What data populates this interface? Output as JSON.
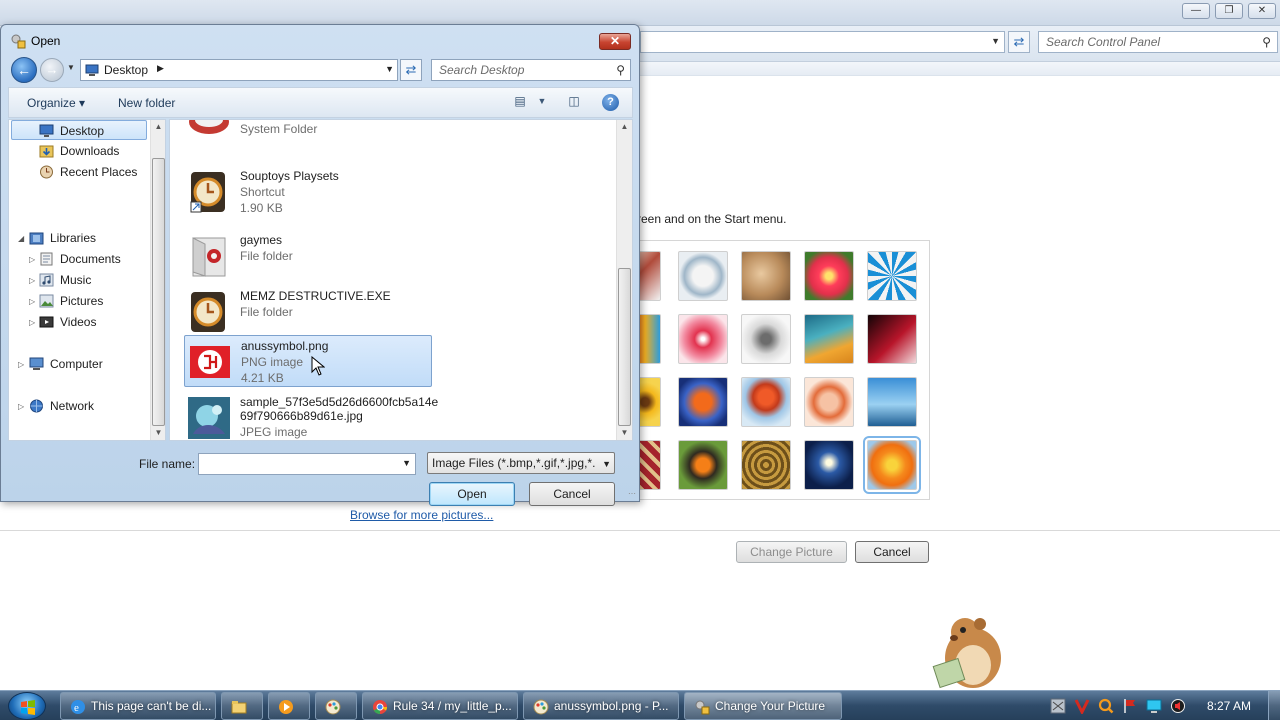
{
  "control_panel": {
    "search_placeholder": "Search Control Panel",
    "description": "reen and on the Start menu.",
    "browse_link": "Browse for more pictures...",
    "change_picture_button": "Change Picture",
    "cancel_button": "Cancel",
    "window_controls": [
      "minimize",
      "restore",
      "close"
    ]
  },
  "dialog": {
    "title": "Open",
    "location": "Desktop",
    "search_placeholder": "Search Desktop",
    "toolbar": {
      "organize": "Organize",
      "new_folder": "New folder"
    },
    "nav": {
      "favorites": [
        {
          "label": "Desktop",
          "icon": "desktop-icon",
          "selected": true
        },
        {
          "label": "Downloads",
          "icon": "downloads-icon"
        },
        {
          "label": "Recent Places",
          "icon": "recent-places-icon"
        }
      ],
      "libraries": {
        "label": "Libraries",
        "items": [
          {
            "label": "Documents",
            "icon": "documents-icon"
          },
          {
            "label": "Music",
            "icon": "music-icon"
          },
          {
            "label": "Pictures",
            "icon": "pictures-icon"
          },
          {
            "label": "Videos",
            "icon": "videos-icon"
          }
        ]
      },
      "computer": "Computer",
      "network": "Network"
    },
    "files": [
      {
        "name": "",
        "type": "System Folder",
        "size": "",
        "icon": "system-folder-icon"
      },
      {
        "name": "Souptoys Playsets",
        "type": "Shortcut",
        "size": "1.90 KB",
        "icon": "clock-shortcut-icon"
      },
      {
        "name": "gaymes",
        "type": "File folder",
        "size": "",
        "icon": "media-folder-icon"
      },
      {
        "name": "MEMZ DESTRUCTIVE.EXE",
        "type": "File folder",
        "size": "",
        "icon": "clock-folder-icon"
      },
      {
        "name": "anussymbol.png",
        "type": "PNG image",
        "size": "4.21 KB",
        "icon": "red-image-thumbnail",
        "selected": true
      },
      {
        "name": "sample_57f3e5d5d26d6600fcb5a14e",
        "name2": "69f790666b89d61e.jpg",
        "type": "JPEG image",
        "size": "",
        "icon": "jpeg-thumbnail"
      }
    ],
    "file_name_label": "File name:",
    "file_name_value": "",
    "file_type": "Image Files (*.bmp,*.gif,*.jpg,*.",
    "open_button": "Open",
    "cancel_button": "Cancel"
  },
  "taskbar": {
    "buttons": [
      {
        "label": "This page can't be di...",
        "icon": "ie-icon"
      },
      {
        "label": "",
        "icon": "explorer-icon"
      },
      {
        "label": "",
        "icon": "media-player-icon"
      },
      {
        "label": "",
        "icon": "paint-icon"
      },
      {
        "label": "Rule 34 / my_little_p...",
        "icon": "chrome-icon"
      },
      {
        "label": "anussymbol.png - P...",
        "icon": "paint-icon"
      },
      {
        "label": "Change Your Picture",
        "icon": "control-panel-icon"
      }
    ],
    "clock": "8:27 AM"
  },
  "colors": {
    "accent": "#2b6ec0",
    "selection": "#c1dcf8",
    "link": "#1f5ba8",
    "taskbar": "#2f4b69"
  }
}
